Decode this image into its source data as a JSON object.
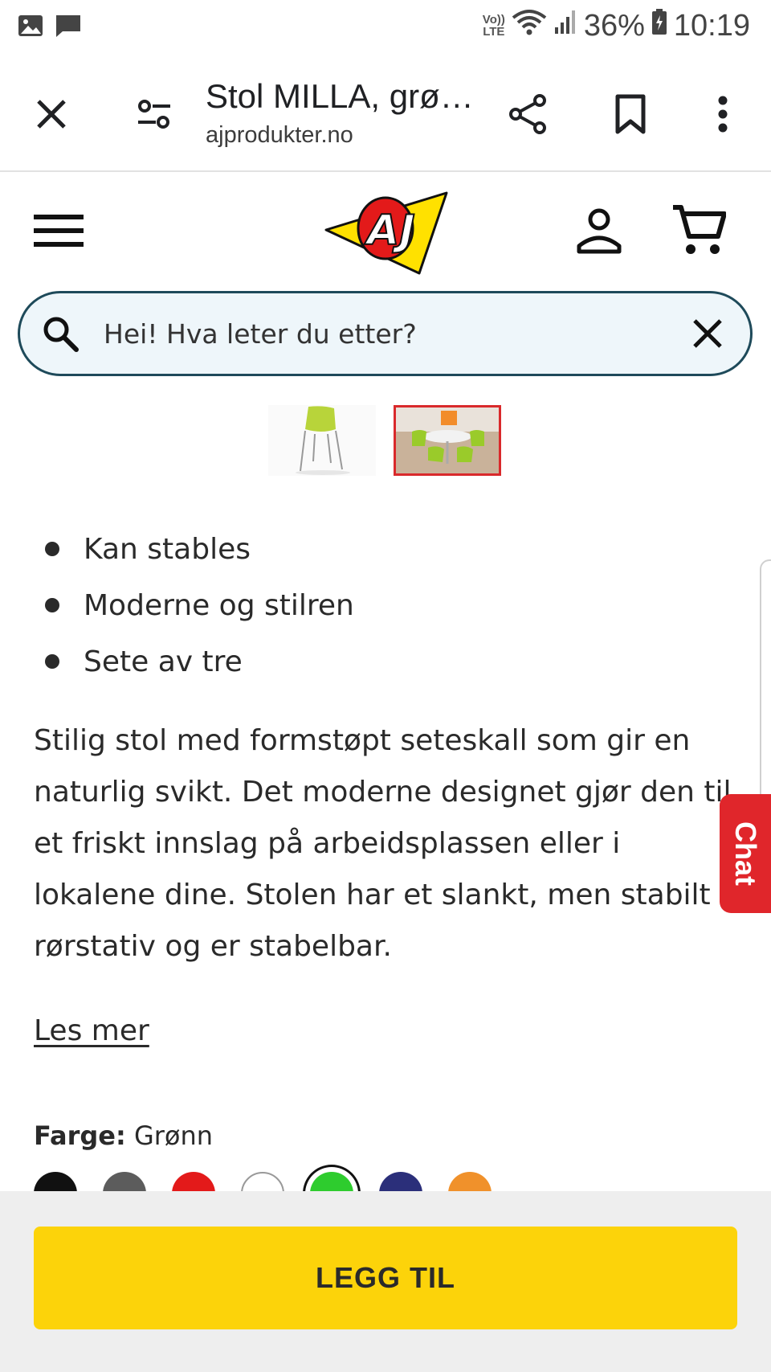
{
  "status_bar": {
    "volte_top": "Vo))",
    "volte_bottom": "LTE",
    "battery": "36%",
    "time": "10:19"
  },
  "browser": {
    "title": "Stol MILLA, grø…",
    "url": "ajprodukter.no"
  },
  "site": {
    "logo_text": "AJ"
  },
  "search": {
    "placeholder": "Hei! Hva leter du etter?"
  },
  "product": {
    "bullets": [
      "Kan stables",
      "Moderne og stilren",
      "Sete av tre"
    ],
    "description": "Stilig stol med formstøpt seteskall som gir en naturlig svikt. Det moderne designet gjør den til et friskt innslag på arbeidsplassen eller i lokalene dine. Stolen har et slankt, men stabilt rørstativ og er stabelbar.",
    "read_more": "Les mer",
    "color_label": "Farge:",
    "color_value": "Grønn",
    "swatch_colors": [
      "#111111",
      "#5c5c5c",
      "#e31a1a",
      "#ffffff",
      "#2ecc2e",
      "#2b2f7a",
      "#f0912b"
    ],
    "selected_swatch": 4
  },
  "chat": {
    "label": "Chat"
  },
  "cta": {
    "add_label": "LEGG TIL"
  },
  "colors": {
    "accent_yellow": "#fcd30a",
    "brand_red": "#e0262b",
    "search_border": "#1e4a5a"
  }
}
